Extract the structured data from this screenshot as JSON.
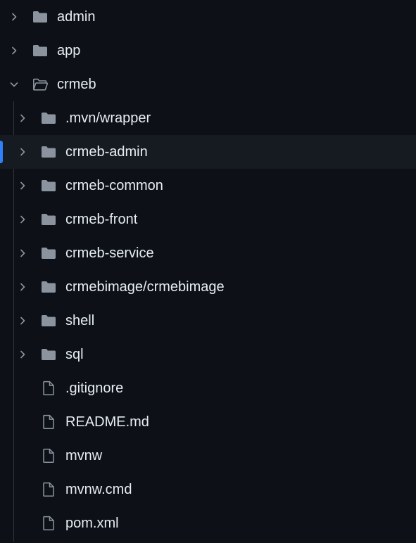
{
  "file_tree": {
    "rows": [
      {
        "label": "admin",
        "type": "folder",
        "expanded": false,
        "level": 0
      },
      {
        "label": "app",
        "type": "folder",
        "expanded": false,
        "level": 0
      },
      {
        "label": "crmeb",
        "type": "folder",
        "expanded": true,
        "level": 0
      },
      {
        "label": ".mvn/wrapper",
        "type": "folder",
        "expanded": false,
        "level": 1
      },
      {
        "label": "crmeb-admin",
        "type": "folder",
        "expanded": false,
        "level": 1,
        "selected": true
      },
      {
        "label": "crmeb-common",
        "type": "folder",
        "expanded": false,
        "level": 1
      },
      {
        "label": "crmeb-front",
        "type": "folder",
        "expanded": false,
        "level": 1
      },
      {
        "label": "crmeb-service",
        "type": "folder",
        "expanded": false,
        "level": 1
      },
      {
        "label": "crmebimage/crmebimage",
        "type": "folder",
        "expanded": false,
        "level": 1
      },
      {
        "label": "shell",
        "type": "folder",
        "expanded": false,
        "level": 1
      },
      {
        "label": "sql",
        "type": "folder",
        "expanded": false,
        "level": 1
      },
      {
        "label": ".gitignore",
        "type": "file",
        "level": 1
      },
      {
        "label": "README.md",
        "type": "file",
        "level": 1
      },
      {
        "label": "mvnw",
        "type": "file",
        "level": 1
      },
      {
        "label": "mvnw.cmd",
        "type": "file",
        "level": 1
      },
      {
        "label": "pom.xml",
        "type": "file",
        "level": 1
      }
    ]
  },
  "icons": {
    "folder": "folder-icon",
    "folder_open": "folder-open-icon",
    "file": "file-icon",
    "collapsed": "chevron-right-icon",
    "expanded": "chevron-down-icon"
  },
  "colors": {
    "background": "#0d1117",
    "selected_row": "#161b22",
    "active_indicator": "#2f81f7",
    "text": "#e6edf3",
    "icon": "#8b949e",
    "indent_guide": "#30363d"
  }
}
